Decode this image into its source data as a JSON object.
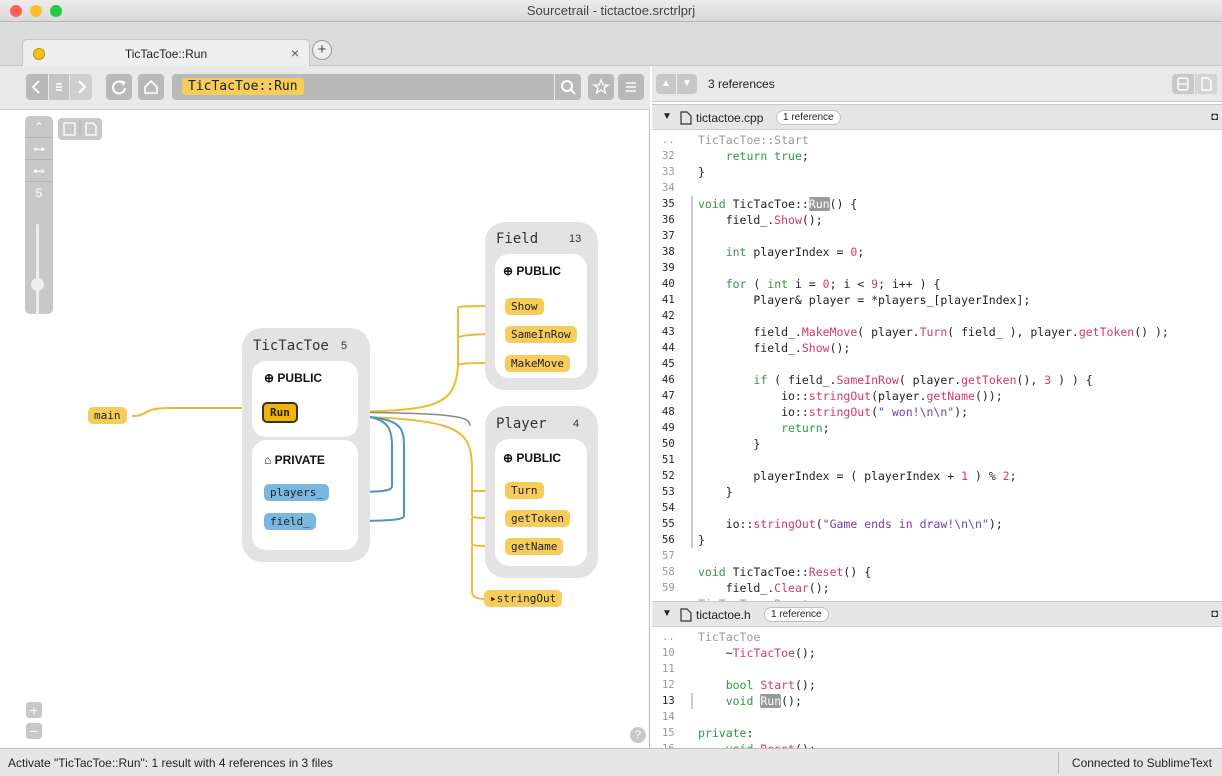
{
  "window": {
    "title": "Sourcetrail - tictactoe.srctrlprj"
  },
  "tabs": [
    {
      "label": "TicTacToe::Run",
      "close": "×"
    }
  ],
  "add_tab": "+",
  "search": {
    "query": "TicTacToe::Run"
  },
  "graph": {
    "depth_value": "5",
    "zoom_in": "+",
    "zoom_out": "−",
    "help": "?",
    "nodes": {
      "tictactoe": {
        "title": "TicTacToe",
        "count": "5",
        "public_label": "PUBLIC",
        "private_label": "PRIVATE",
        "public_members": [
          "Run"
        ],
        "private_members": [
          "players_",
          "field_"
        ]
      },
      "field": {
        "title": "Field",
        "count": "13",
        "public_label": "PUBLIC",
        "members": [
          "Show",
          "SameInRow",
          "MakeMove"
        ]
      },
      "player": {
        "title": "Player",
        "count": "4",
        "public_label": "PUBLIC",
        "members": [
          "Turn",
          "getToken",
          "getName"
        ]
      },
      "main": "main",
      "stringout": "stringOut"
    },
    "colors": {
      "function": "#f6cd5a",
      "variable": "#7ab7e0",
      "call_edge": "#f2b835",
      "access_edge": "#4b94c4"
    }
  },
  "references": {
    "summary": "3 references"
  },
  "files": [
    {
      "name": "tictactoe.cpp",
      "badge": "1 reference",
      "context_top": "TicTacToe::Start",
      "context_bottom": "TicTacToe::Reset",
      "lines": [
        {
          "n": "32",
          "segs": [
            {
              "t": "    "
            },
            {
              "t": "return true",
              "c": "kw"
            },
            {
              "t": ";"
            }
          ]
        },
        {
          "n": "33",
          "segs": [
            {
              "t": "}"
            }
          ]
        },
        {
          "n": "34",
          "segs": [
            {
              "t": ""
            }
          ]
        },
        {
          "n": "35",
          "active": true,
          "segs": [
            {
              "t": "void",
              "c": "kw"
            },
            {
              "t": " TicTacToe::"
            },
            {
              "t": "Run",
              "c": "hl"
            },
            {
              "t": "() {"
            }
          ]
        },
        {
          "n": "36",
          "active": true,
          "segs": [
            {
              "t": "    field_."
            },
            {
              "t": "Show",
              "c": "fn"
            },
            {
              "t": "();"
            }
          ]
        },
        {
          "n": "37",
          "active": true,
          "segs": [
            {
              "t": ""
            }
          ]
        },
        {
          "n": "38",
          "active": true,
          "segs": [
            {
              "t": "    "
            },
            {
              "t": "int",
              "c": "kw"
            },
            {
              "t": " playerIndex = "
            },
            {
              "t": "0",
              "c": "num"
            },
            {
              "t": ";"
            }
          ]
        },
        {
          "n": "39",
          "active": true,
          "segs": [
            {
              "t": ""
            }
          ]
        },
        {
          "n": "40",
          "active": true,
          "segs": [
            {
              "t": "    "
            },
            {
              "t": "for",
              "c": "kw"
            },
            {
              "t": " ( "
            },
            {
              "t": "int",
              "c": "kw"
            },
            {
              "t": " i = "
            },
            {
              "t": "0",
              "c": "num"
            },
            {
              "t": "; i < "
            },
            {
              "t": "9",
              "c": "num"
            },
            {
              "t": "; i++ ) {"
            }
          ]
        },
        {
          "n": "41",
          "active": true,
          "segs": [
            {
              "t": "        Player& player = *players_[playerIndex];"
            }
          ]
        },
        {
          "n": "42",
          "active": true,
          "segs": [
            {
              "t": ""
            }
          ]
        },
        {
          "n": "43",
          "active": true,
          "segs": [
            {
              "t": "        field_."
            },
            {
              "t": "MakeMove",
              "c": "fn"
            },
            {
              "t": "( player."
            },
            {
              "t": "Turn",
              "c": "fn"
            },
            {
              "t": "( field_ ), player."
            },
            {
              "t": "getToken",
              "c": "fn"
            },
            {
              "t": "() );"
            }
          ]
        },
        {
          "n": "44",
          "active": true,
          "segs": [
            {
              "t": "        field_."
            },
            {
              "t": "Show",
              "c": "fn"
            },
            {
              "t": "();"
            }
          ]
        },
        {
          "n": "45",
          "active": true,
          "segs": [
            {
              "t": ""
            }
          ]
        },
        {
          "n": "46",
          "active": true,
          "segs": [
            {
              "t": "        "
            },
            {
              "t": "if",
              "c": "kw"
            },
            {
              "t": " ( field_."
            },
            {
              "t": "SameInRow",
              "c": "fn"
            },
            {
              "t": "( player."
            },
            {
              "t": "getToken",
              "c": "fn"
            },
            {
              "t": "(), "
            },
            {
              "t": "3",
              "c": "num"
            },
            {
              "t": " ) ) {"
            }
          ]
        },
        {
          "n": "47",
          "active": true,
          "segs": [
            {
              "t": "            io::"
            },
            {
              "t": "stringOut",
              "c": "fn"
            },
            {
              "t": "(player."
            },
            {
              "t": "getName",
              "c": "fn"
            },
            {
              "t": "());"
            }
          ]
        },
        {
          "n": "48",
          "active": true,
          "segs": [
            {
              "t": "            io::"
            },
            {
              "t": "stringOut",
              "c": "fn"
            },
            {
              "t": "("
            },
            {
              "t": "\" won!\\n\\n\"",
              "c": "str"
            },
            {
              "t": ");"
            }
          ]
        },
        {
          "n": "49",
          "active": true,
          "segs": [
            {
              "t": "            "
            },
            {
              "t": "return",
              "c": "kw"
            },
            {
              "t": ";"
            }
          ]
        },
        {
          "n": "50",
          "active": true,
          "segs": [
            {
              "t": "        }"
            }
          ]
        },
        {
          "n": "51",
          "active": true,
          "segs": [
            {
              "t": ""
            }
          ]
        },
        {
          "n": "52",
          "active": true,
          "segs": [
            {
              "t": "        playerIndex = ( playerIndex + "
            },
            {
              "t": "1",
              "c": "num"
            },
            {
              "t": " ) % "
            },
            {
              "t": "2",
              "c": "num"
            },
            {
              "t": ";"
            }
          ]
        },
        {
          "n": "53",
          "active": true,
          "segs": [
            {
              "t": "    }"
            }
          ]
        },
        {
          "n": "54",
          "active": true,
          "segs": [
            {
              "t": ""
            }
          ]
        },
        {
          "n": "55",
          "active": true,
          "segs": [
            {
              "t": "    io::"
            },
            {
              "t": "stringOut",
              "c": "fn"
            },
            {
              "t": "("
            },
            {
              "t": "\"Game ends in draw!\\n\\n\"",
              "c": "str"
            },
            {
              "t": ");"
            }
          ]
        },
        {
          "n": "56",
          "active": true,
          "segs": [
            {
              "t": "}"
            }
          ]
        },
        {
          "n": "57",
          "segs": [
            {
              "t": ""
            }
          ]
        },
        {
          "n": "58",
          "segs": [
            {
              "t": "void",
              "c": "kw"
            },
            {
              "t": " TicTacToe::"
            },
            {
              "t": "Reset",
              "c": "fn"
            },
            {
              "t": "() {"
            }
          ]
        },
        {
          "n": "59",
          "segs": [
            {
              "t": "    field_."
            },
            {
              "t": "Clear",
              "c": "fn"
            },
            {
              "t": "();"
            }
          ]
        }
      ]
    },
    {
      "name": "tictactoe.h",
      "badge": "1 reference",
      "context_top": "TicTacToe",
      "lines": [
        {
          "n": "10",
          "segs": [
            {
              "t": "    ~"
            },
            {
              "t": "TicTacToe",
              "c": "fn"
            },
            {
              "t": "();"
            }
          ]
        },
        {
          "n": "11",
          "segs": [
            {
              "t": ""
            }
          ]
        },
        {
          "n": "12",
          "segs": [
            {
              "t": "    "
            },
            {
              "t": "bool",
              "c": "kw"
            },
            {
              "t": " "
            },
            {
              "t": "Start",
              "c": "fn"
            },
            {
              "t": "();"
            }
          ]
        },
        {
          "n": "13",
          "active": true,
          "segs": [
            {
              "t": "    "
            },
            {
              "t": "void",
              "c": "kw"
            },
            {
              "t": " "
            },
            {
              "t": "Run",
              "c": "hl"
            },
            {
              "t": "();"
            }
          ]
        },
        {
          "n": "14",
          "segs": [
            {
              "t": ""
            }
          ]
        },
        {
          "n": "15",
          "segs": [
            {
              "t": "private",
              "c": "kw"
            },
            {
              "t": ":"
            }
          ]
        },
        {
          "n": "16",
          "segs": [
            {
              "t": "    "
            },
            {
              "t": "void",
              "c": "kw"
            },
            {
              "t": " "
            },
            {
              "t": "Reset",
              "c": "fn"
            },
            {
              "t": "();"
            }
          ]
        }
      ]
    }
  ],
  "status": {
    "message": "Activate \"TicTacToe::Run\": 1 result with 4 references in 3 files",
    "connection": "Connected to SublimeText"
  }
}
